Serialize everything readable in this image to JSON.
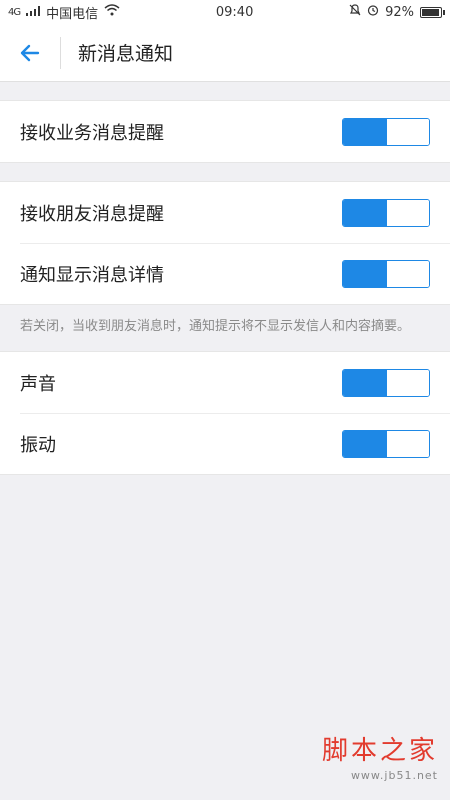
{
  "status_bar": {
    "signal_text": "4G",
    "carrier": "中国电信",
    "time": "09:40",
    "battery": "92%",
    "battery_level": 0.92
  },
  "header": {
    "back_icon": "arrow-left-icon",
    "title": "新消息通知"
  },
  "groups": [
    {
      "rows": [
        {
          "label": "接收业务消息提醒",
          "enabled": true
        }
      ]
    },
    {
      "rows": [
        {
          "label": "接收朋友消息提醒",
          "enabled": true
        },
        {
          "label": "通知显示消息详情",
          "enabled": true
        }
      ],
      "hint": "若关闭，当收到朋友消息时，通知提示将不显示发信人和内容摘要。"
    },
    {
      "rows": [
        {
          "label": "声音",
          "enabled": true
        },
        {
          "label": "振动",
          "enabled": true
        }
      ]
    }
  ],
  "colors": {
    "accent": "#1e88e5",
    "background": "#f0f0f3"
  },
  "watermark": {
    "main": "脚本之家",
    "sub": "www.jb51.net"
  }
}
